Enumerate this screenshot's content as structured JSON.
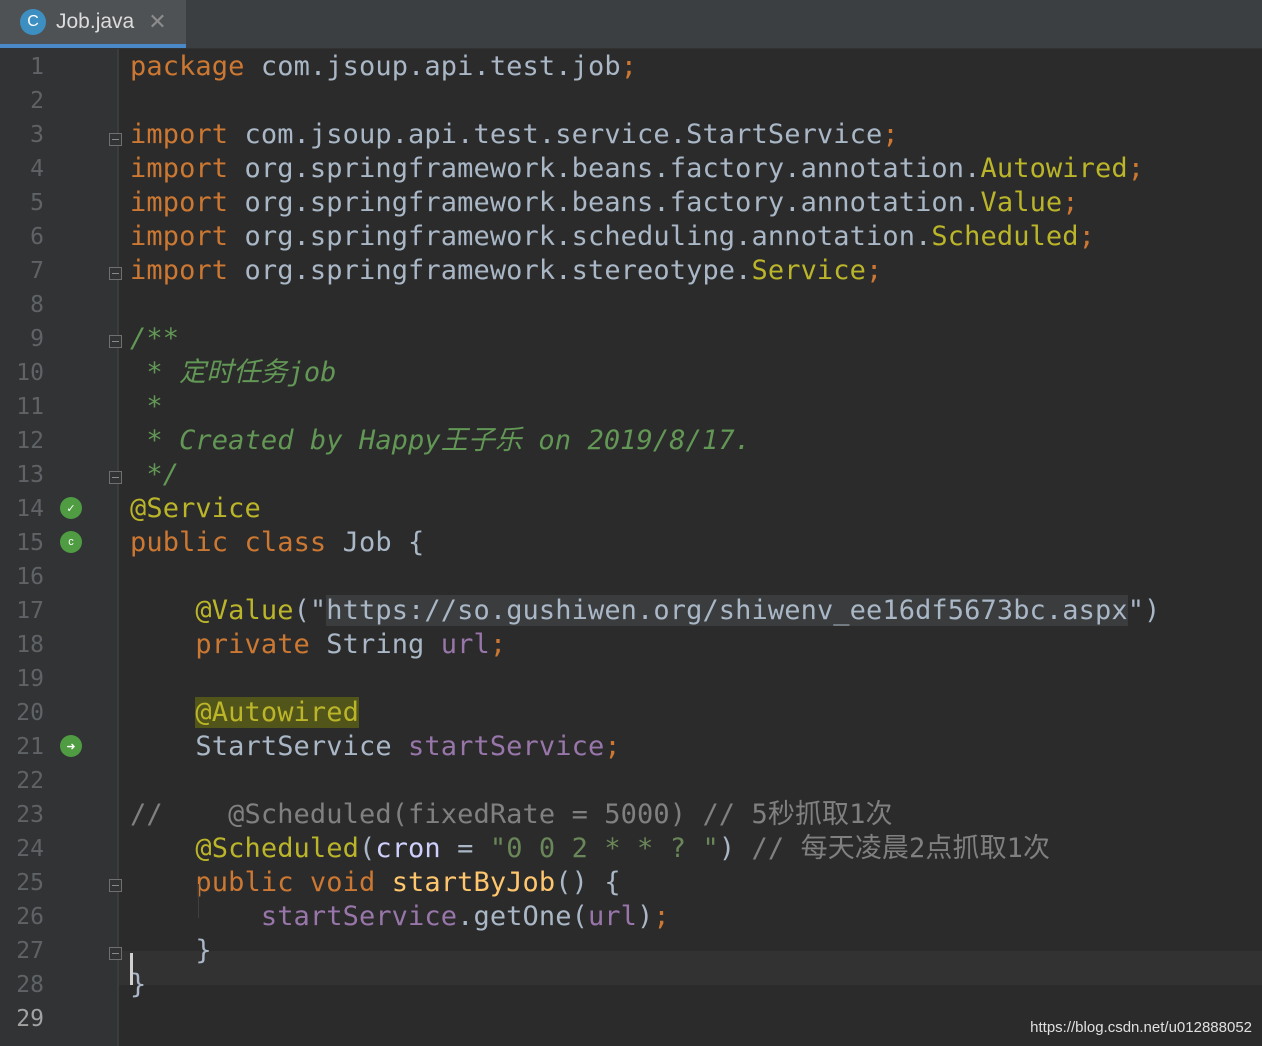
{
  "tab": {
    "icon_letter": "C",
    "label": "Job.java",
    "close": "✕"
  },
  "lines": [
    "1",
    "2",
    "3",
    "4",
    "5",
    "6",
    "7",
    "8",
    "9",
    "10",
    "11",
    "12",
    "13",
    "14",
    "15",
    "16",
    "17",
    "18",
    "19",
    "20",
    "21",
    "22",
    "23",
    "24",
    "25",
    "26",
    "27",
    "28",
    "29"
  ],
  "code": {
    "l1": [
      "package",
      " com.jsoup.api.test.job",
      ";"
    ],
    "l3": [
      "import",
      " com.jsoup.api.test.service.StartService",
      ";"
    ],
    "l4": [
      "import",
      " org.springframework.beans.factory.annotation.",
      "Autowired",
      ";"
    ],
    "l5": [
      "import",
      " org.springframework.beans.factory.annotation.",
      "Value",
      ";"
    ],
    "l6": [
      "import",
      " org.springframework.scheduling.annotation.",
      "Scheduled",
      ";"
    ],
    "l7": [
      "import",
      " org.springframework.stereotype.",
      "Service",
      ";"
    ],
    "l9": "/**",
    "l10": " * 定时任务job",
    "l11": " *",
    "l12": " * Created by Happy王子乐 on 2019/8/17.",
    "l13": " */",
    "l14": "@Service",
    "l15": [
      "public",
      " ",
      "class",
      " Job {"
    ],
    "l17": [
      "    ",
      "@Value",
      "(\"",
      "https://so.gushiwen.org/shiwenv_ee16df5673bc.aspx",
      "\")"
    ],
    "l18": [
      "    ",
      "private",
      " String ",
      "url",
      ";"
    ],
    "l20": [
      "    ",
      "@Autowired"
    ],
    "l21": [
      "    StartService ",
      "startService",
      ";"
    ],
    "l23": "//    @Scheduled(fixedRate = 5000) // 5秒抓取1次",
    "l24": [
      "    ",
      "@Scheduled",
      "(",
      "cron",
      " = ",
      "\"0 0 2 * * ? \"",
      ") ",
      "// 每天凌晨2点抓取1次"
    ],
    "l25": [
      "    ",
      "public",
      " ",
      "void",
      " ",
      "startByJob",
      "() {"
    ],
    "l26": [
      "        ",
      "startService",
      ".getOne(",
      "url",
      ")",
      ";"
    ],
    "l27": "    }",
    "l28": "}"
  },
  "watermark": "https://blog.csdn.net/u012888052",
  "colors": {
    "background": "#2b2b2b",
    "keyword": "#cc7832",
    "annotation": "#bbb529",
    "doc_comment": "#629755",
    "line_comment": "#808080",
    "string": "#6a8759",
    "field": "#9876aa",
    "method": "#ffc66d"
  }
}
